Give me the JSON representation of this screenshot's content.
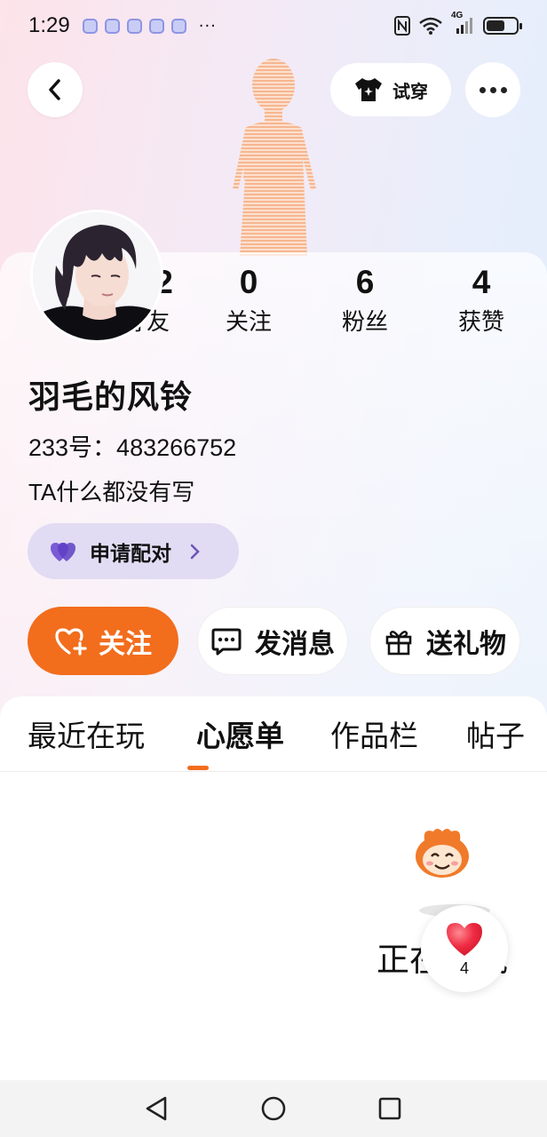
{
  "status_bar": {
    "time": "1:29",
    "more": "···",
    "network": "4G"
  },
  "header": {
    "try_on_label": "试穿"
  },
  "stats": [
    {
      "value": "112",
      "label": "好友"
    },
    {
      "value": "0",
      "label": "关注"
    },
    {
      "value": "6",
      "label": "粉丝"
    },
    {
      "value": "4",
      "label": "获赞"
    }
  ],
  "profile": {
    "name": "羽毛的风铃",
    "id_text": "233号：483266752",
    "bio": "TA什么都没有写",
    "match_label": "申请配对"
  },
  "actions": {
    "follow_label": "关注",
    "message_label": "发消息",
    "gift_label": "送礼物"
  },
  "tabs": [
    {
      "label": "最近在玩",
      "active": false
    },
    {
      "label": "心愿单",
      "active": true
    },
    {
      "label": "作品栏",
      "active": false
    },
    {
      "label": "帖子",
      "active": false
    }
  ],
  "content": {
    "loading_text": "正在加载"
  },
  "like_float": {
    "count": "4"
  },
  "colors": {
    "accent": "#f26d1c",
    "match_bg": "#e1dcf3",
    "heart": "#e8243a"
  }
}
